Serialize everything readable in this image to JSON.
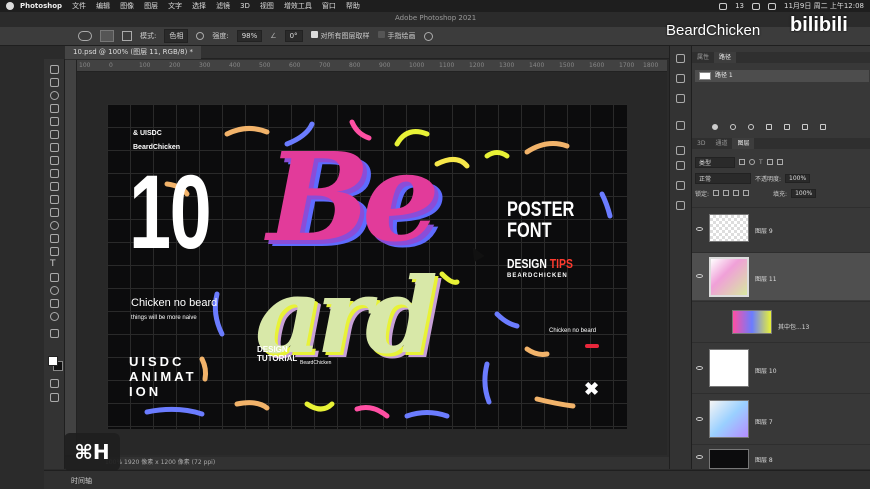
{
  "menubar": {
    "app": "Photoshop",
    "items": [
      "文件",
      "编辑",
      "图像",
      "图层",
      "文字",
      "选择",
      "滤镜",
      "3D",
      "视图",
      "增效工具",
      "窗口",
      "帮助"
    ],
    "window_title": "Adobe Photoshop 2021",
    "notification_count": "13",
    "clock": "11月9日 周二 上午12:08"
  },
  "options": {
    "mode_label": "模式:",
    "mode_value": "色相",
    "strength_label": "强度:",
    "strength_value": "98%",
    "angle_value": "0°",
    "sample_all_label": "对所有图层取样",
    "finger_label": "手指绘画"
  },
  "document": {
    "tab": "10.psd @ 100% (图层 11, RGB/8) *",
    "ruler_ticks": [
      "100",
      "0",
      "100",
      "200",
      "300",
      "400",
      "500",
      "600",
      "700",
      "800",
      "900",
      "1000",
      "1100",
      "1200",
      "1300",
      "1400",
      "1500",
      "1600",
      "1700",
      "1800",
      "1900"
    ],
    "status": "100%   1920 像素 x 1200 像素 (72 ppi)"
  },
  "poster": {
    "uisdc": "& UISDC",
    "beardchicken": "BeardChicken",
    "big_number": "10",
    "script_line1": "Be",
    "script_line2": "ard",
    "chicken_no_beard": "Chicken no beard",
    "things": "things will be more naive",
    "animation": "UISDC ANIMAT ION",
    "poster_font": "POSTER FONT",
    "design": "DESIGN",
    "tips": "TIPS",
    "beardchicken_caps": "BEARDCHICKEN",
    "chicken_small": "Chicken no beard",
    "design_tutorial": "DESIGN TUTORIAL",
    "beardchicken_small": "BeardChicken",
    "x_mark": "✖"
  },
  "paths_panel": {
    "tabs": [
      "属性",
      "路径"
    ],
    "active_tab": "路径",
    "path_name": "路径 1"
  },
  "layers_panel": {
    "tabs": [
      "3D",
      "通道",
      "图层"
    ],
    "active_tab": "图层",
    "kind": "类型",
    "blend_mode": "正常",
    "opacity_label": "不透明度:",
    "opacity_value": "100%",
    "lock_label": "锁定:",
    "fill_label": "填充:",
    "fill_value": "100%",
    "layers": [
      {
        "name": "图层 9",
        "selected": false
      },
      {
        "name": "图层 11",
        "selected": true
      },
      {
        "name": "其中包...13",
        "selected": false
      },
      {
        "name": "图层 10",
        "selected": false
      },
      {
        "name": "图层 7",
        "selected": false
      },
      {
        "name": "图层 8",
        "selected": false
      }
    ]
  },
  "timeline": {
    "label": "时间轴"
  },
  "overlay": {
    "shortcut": "⌘H",
    "channel_name": "BeardChicken",
    "site_logo": "bilibili"
  },
  "colors": {
    "poster_bg": "#0c0c0d",
    "accent_yellow": "#e8f236",
    "accent_red": "#ff3b2f",
    "accent_pink": "#e8273b"
  }
}
